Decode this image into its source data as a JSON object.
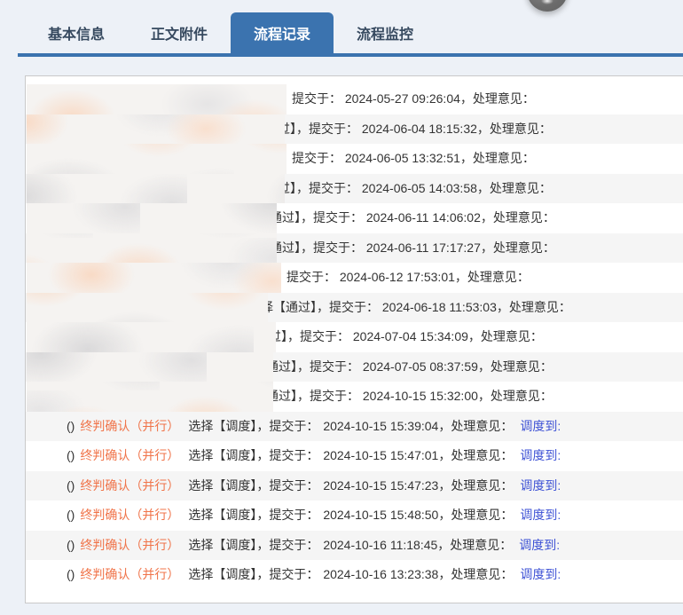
{
  "colors": {
    "accent_blue": "#3b73af",
    "stage_orange": "#f0744a",
    "link_blue": "#3e52d5",
    "alt_row_gray": "#f5f5f5",
    "page_bg": "#edf1f7"
  },
  "floating_button": {
    "shape": "gray-circle"
  },
  "tabs": [
    {
      "label": "基本信息",
      "active": false
    },
    {
      "label": "正文附件",
      "active": false
    },
    {
      "label": "流程记录",
      "active": true
    },
    {
      "label": "流程监控",
      "active": false
    }
  ],
  "records": [
    {
      "redacted": true,
      "blur_w": 293,
      "tail": "，提交于： 2024-05-27 09:26:04，处理意见："
    },
    {
      "redacted": true,
      "blur_w": 291,
      "tail": "过】，提交于： 2024-06-04 18:15:32，处理意见："
    },
    {
      "redacted": true,
      "blur_w": 293,
      "tail": "，提交于： 2024-06-05 13:32:51，处理意见："
    },
    {
      "redacted": true,
      "blur_w": 291,
      "tail": "过】，提交于： 2024-06-05 14:03:58，处理意见："
    },
    {
      "redacted": true,
      "blur_w": 282,
      "tail": "通过】，提交于： 2024-06-11 14:06:02，处理意见："
    },
    {
      "redacted": true,
      "blur_w": 282,
      "tail": "通过】，提交于： 2024-06-11 17:17:27，处理意见："
    },
    {
      "redacted": true,
      "blur_w": 287,
      "tail": "，提交于： 2024-06-12 17:53:01，处理意见："
    },
    {
      "redacted": true,
      "blur_w": 272,
      "tail": "择【通过】，提交于： 2024-06-18 11:53:03，处理意见："
    },
    {
      "redacted": true,
      "blur_w": 281,
      "tail": "过】，提交于： 2024-07-04 15:34:09，处理意见："
    },
    {
      "redacted": true,
      "blur_w": 278,
      "tail": "通过】，提交于： 2024-07-05 08:37:59，处理意见："
    },
    {
      "redacted": true,
      "blur_w": 278,
      "tail": "通过】，提交于： 2024-10-15 15:32:00，处理意见："
    },
    {
      "redacted": false,
      "prefix": "()",
      "stage": "终判确认（并行）",
      "action": "选择【调度】，提交于：",
      "time": "2024-10-15 15:39:04",
      "suffix": "，处理意见：",
      "link": "调度到:"
    },
    {
      "redacted": false,
      "prefix": "()",
      "stage": "终判确认（并行）",
      "action": "选择【调度】，提交于：",
      "time": "2024-10-15 15:47:01",
      "suffix": "，处理意见：",
      "link": "调度到:"
    },
    {
      "redacted": false,
      "prefix": "()",
      "stage": "终判确认（并行）",
      "action": "选择【调度】，提交于：",
      "time": "2024-10-15 15:47:23",
      "suffix": "，处理意见：",
      "link": "调度到:"
    },
    {
      "redacted": false,
      "prefix": "()",
      "stage": "终判确认（并行）",
      "action": "选择【调度】，提交于：",
      "time": "2024-10-15 15:48:50",
      "suffix": "，处理意见：",
      "link": "调度到:"
    },
    {
      "redacted": false,
      "prefix": "()",
      "stage": "终判确认（并行）",
      "action": "选择【调度】，提交于：",
      "time": "2024-10-16 11:18:45",
      "suffix": "，处理意见：",
      "link": "调度到:"
    },
    {
      "redacted": false,
      "prefix": "()",
      "stage": "终判确认（并行）",
      "action": "选择【调度】，提交于：",
      "time": "2024-10-16 13:23:38",
      "suffix": "，处理意见：",
      "link": "调度到:"
    }
  ]
}
